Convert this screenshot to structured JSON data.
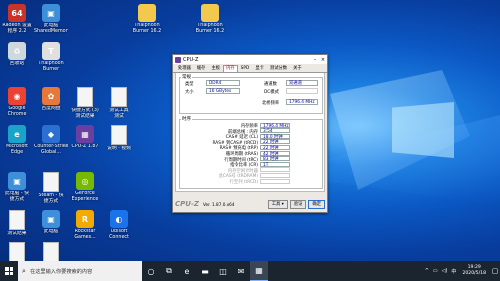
{
  "desktop": {
    "icons": [
      {
        "label": "Radeon 设置\n程序 2.2",
        "icon": "aida64-icon",
        "color": "#c8342a",
        "glyph": "64"
      },
      {
        "label": "此电脑\nSharedMemory",
        "icon": "computer-icon",
        "color": "#3c8fd8",
        "glyph": "▣"
      },
      {
        "label": "Thaiphoon\nBurner 16.2",
        "icon": "folder-icon",
        "color": "#f2c94c",
        "glyph": ""
      },
      {
        "label": "Thaiphoon\nBurner 16.2",
        "icon": "folder-icon",
        "color": "#f2c94c",
        "glyph": ""
      },
      {
        "label": "回收站",
        "icon": "recycle-bin-icon",
        "color": "#cfd8dc",
        "glyph": "♻"
      },
      {
        "label": "Thaiphoon\nBurner",
        "icon": "thaiphoon-icon",
        "color": "#e0e0e0",
        "glyph": "T"
      },
      {
        "label": "Google\nChrome",
        "icon": "chrome-icon",
        "color": "#ea4335",
        "glyph": "◉"
      },
      {
        "label": "百度网盘",
        "icon": "fan-icon",
        "color": "#e8773a",
        "glyph": "✿"
      },
      {
        "label": "快捷方式 (3)\n测试结果",
        "icon": "file-icon",
        "color": "#f5f5f5",
        "glyph": ""
      },
      {
        "label": "测试工具\n测试",
        "icon": "file-icon",
        "color": "#f5f5f5",
        "glyph": ""
      },
      {
        "label": "Microsoft\nEdge",
        "icon": "edge-icon",
        "color": "#1aa3c9",
        "glyph": "e"
      },
      {
        "label": "Counter-Strike\nGlobal...",
        "icon": "game-icon",
        "color": "#2b6fd1",
        "glyph": "◆"
      },
      {
        "label": "CPU-Z 1.87",
        "icon": "cpuz-icon",
        "color": "#6a3fa0",
        "glyph": "▦"
      },
      {
        "label": "说明 · 视频",
        "icon": "file-icon",
        "color": "#f5f5f5",
        "glyph": ""
      },
      {
        "label": "此电脑 - 快\n捷方式",
        "icon": "computer-icon",
        "color": "#3c8fd8",
        "glyph": "▣"
      },
      {
        "label": "Steam - 快\n捷方式",
        "icon": "file-icon",
        "color": "#f5f5f5",
        "glyph": ""
      },
      {
        "label": "GeForce\nExperience",
        "icon": "nvidia-icon",
        "color": "#76b900",
        "glyph": "◎"
      },
      {
        "label": "测试结果",
        "icon": "file-icon",
        "color": "#f5f5f5",
        "glyph": ""
      },
      {
        "label": "此电脑",
        "icon": "computer-icon",
        "color": "#3c8fd8",
        "glyph": "▣"
      },
      {
        "label": "Rockstar\nGames...",
        "icon": "rockstar-icon",
        "color": "#f2a900",
        "glyph": "R"
      },
      {
        "label": "Ubisoft\nConnect",
        "icon": "ubisoft-icon",
        "color": "#1a73e8",
        "glyph": "◐"
      },
      {
        "label": "说明 · 视频\n测试",
        "icon": "file-icon",
        "color": "#f5f5f5",
        "glyph": ""
      },
      {
        "label": "控制面板",
        "icon": "file-icon",
        "color": "#f5f5f5",
        "glyph": ""
      }
    ]
  },
  "cpuz": {
    "title": "CPU-Z",
    "window_buttons": {
      "minimize": "–",
      "close": "×"
    },
    "tabs": [
      "处理器",
      "缓存",
      "主板",
      "内存",
      "SPD",
      "显卡",
      "测试分数",
      "关于"
    ],
    "active_tab": "内存",
    "general": {
      "group": "常规",
      "type_label": "类型",
      "type_value": "DDR4",
      "size_label": "大小",
      "size_value": "16 GBytes",
      "channel_label": "通道数",
      "channel_value": "双通道",
      "dc_label": "DC模式",
      "dc_value": "",
      "uncore_label": "北桥频率",
      "uncore_value": "1796.4 MHz"
    },
    "timings": {
      "group": "时序",
      "rows": [
        {
          "label": "内存频率",
          "value": "1796.4 MHz",
          "enabled": true
        },
        {
          "label": "前端总线 : 内存",
          "value": "3:54",
          "enabled": true
        },
        {
          "label": "CAS# 延迟 (CL)",
          "value": "18.0 时钟",
          "enabled": true
        },
        {
          "label": "RAS# 到CAS# (tRCD)",
          "value": "22 时钟",
          "enabled": true
        },
        {
          "label": "RAS# 预充电 (tRP)",
          "value": "22 时钟",
          "enabled": true
        },
        {
          "label": "循环周期 (tRAS)",
          "value": "42 时钟",
          "enabled": true
        },
        {
          "label": "行周期时间 (tRC)",
          "value": "83 时钟",
          "enabled": true
        },
        {
          "label": "指令比率 (CR)",
          "value": "1T",
          "enabled": true
        },
        {
          "label": "内存空闲计时器",
          "value": "",
          "enabled": false
        },
        {
          "label": "总CAS号 (tRDRAM)",
          "value": "",
          "enabled": false
        },
        {
          "label": "行至列 (tRCD)",
          "value": "",
          "enabled": false
        }
      ]
    },
    "footer": {
      "logo": "CPU-Z",
      "version": "Ver. 1.87.0.x64",
      "tools": "工具 ▾",
      "validate": "验证",
      "ok": "确定"
    }
  },
  "taskbar": {
    "search_placeholder": "在这里输入你要搜索的内容",
    "apps": [
      {
        "name": "cortana-icon",
        "glyph": "○",
        "active": false
      },
      {
        "name": "task-view-icon",
        "glyph": "⧉",
        "active": false
      },
      {
        "name": "edge-icon",
        "glyph": "e",
        "active": false
      },
      {
        "name": "file-explorer-icon",
        "glyph": "▬",
        "active": false
      },
      {
        "name": "store-icon",
        "glyph": "◫",
        "active": false
      },
      {
        "name": "mail-icon",
        "glyph": "✉",
        "active": false
      },
      {
        "name": "cpuz-icon",
        "glyph": "▦",
        "active": true
      }
    ],
    "tray": {
      "chevron": "^",
      "network": "▭",
      "volume": "◁)",
      "ime": "中",
      "time": "19:29",
      "date": "2020/5/18",
      "notification": "▢"
    }
  }
}
